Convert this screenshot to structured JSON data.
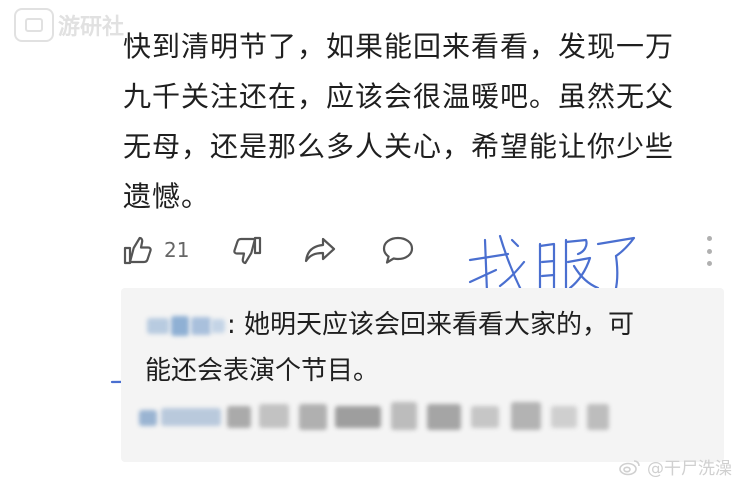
{
  "watermark": {
    "logo_text": "游研社",
    "weibo_text": "@干尸洗澡"
  },
  "comment": {
    "lines": [
      "快到清明节了，如果能回来看看，发现一万",
      "九千关注还在，应该会很温暖吧。虽然无父",
      "无母，还是那么多人关心，希望能让你少些",
      "遗憾。"
    ],
    "like_count": "21"
  },
  "annotation": {
    "text": "我服了"
  },
  "reply": {
    "author_blurred": true,
    "text_line1": ": 她明天应该会回来看看大家的，可",
    "text_line2": "能还会表演个节目。"
  },
  "colors": {
    "text": "#1f1f1f",
    "icon": "#555555",
    "reply_bg": "#f4f4f4",
    "annotation_ink": "#4a6fd0"
  }
}
